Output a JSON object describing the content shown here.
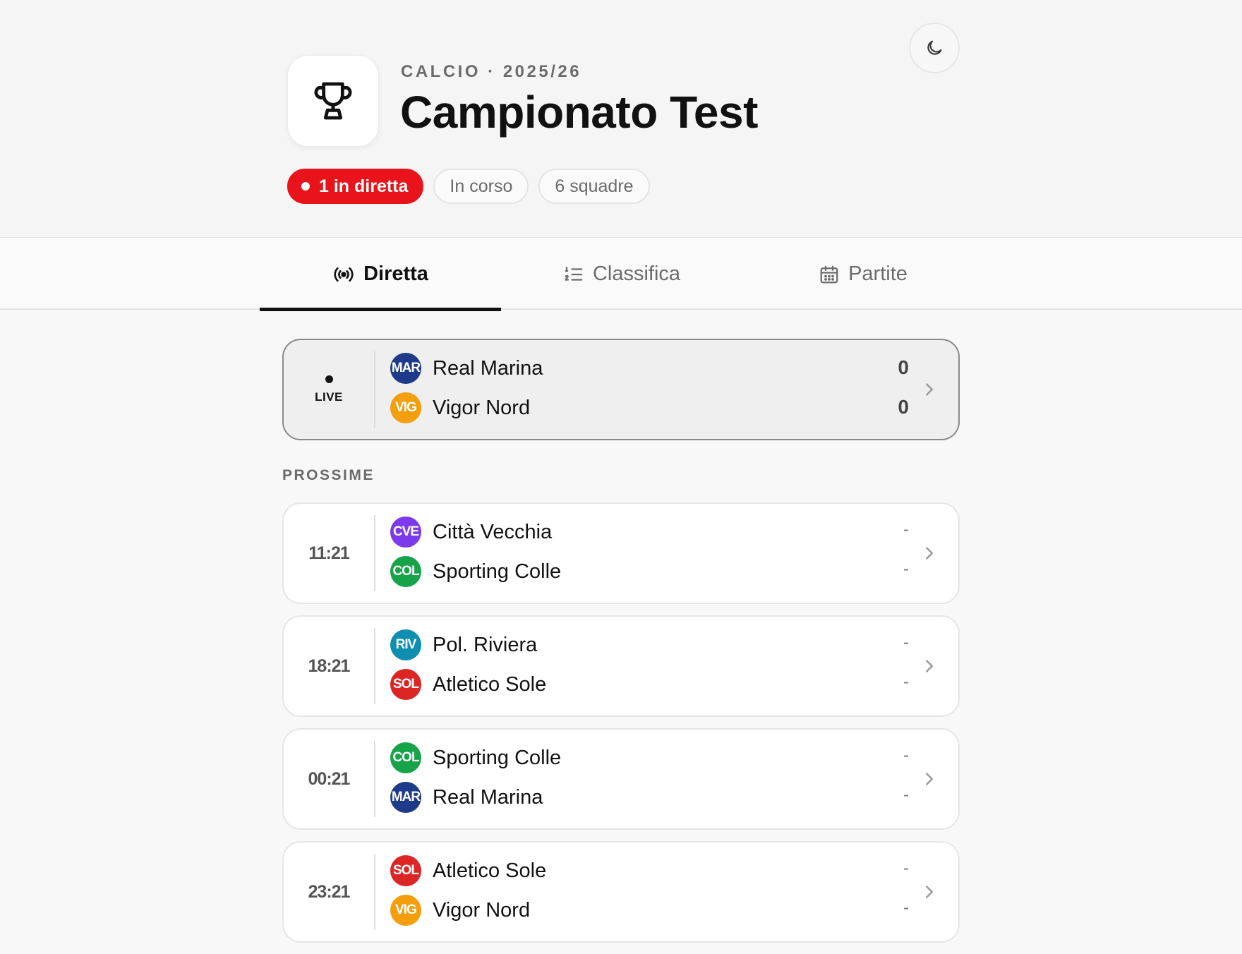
{
  "header": {
    "kicker": "CALCIO · 2025/26",
    "title": "Campionato Test",
    "theme_toggle_icon": "moon-icon",
    "logo_icon": "trophy-icon",
    "pills": {
      "live": "1 in diretta",
      "status": "In corso",
      "teams": "6 squadre"
    }
  },
  "tabs": [
    {
      "label": "Diretta",
      "icon": "broadcast-icon",
      "active": true
    },
    {
      "label": "Classifica",
      "icon": "ranked-list-icon",
      "active": false
    },
    {
      "label": "Partite",
      "icon": "calendar-icon",
      "active": false
    }
  ],
  "live_match": {
    "status": "LIVE",
    "home": {
      "abbr": "MAR",
      "name": "Real Marina",
      "score": "0",
      "color": "#1e3a8a"
    },
    "away": {
      "abbr": "VIG",
      "name": "Vigor Nord",
      "score": "0",
      "color": "#f59e0b"
    }
  },
  "upcoming_label": "PROSSIME",
  "upcoming": [
    {
      "time": "11:21",
      "home": {
        "abbr": "CVE",
        "name": "Città Vecchia",
        "score": "-",
        "color": "#7c3aed"
      },
      "away": {
        "abbr": "COL",
        "name": "Sporting Colle",
        "score": "-",
        "color": "#16a34a"
      }
    },
    {
      "time": "18:21",
      "home": {
        "abbr": "RIV",
        "name": "Pol. Riviera",
        "score": "-",
        "color": "#0e8fb0"
      },
      "away": {
        "abbr": "SOL",
        "name": "Atletico Sole",
        "score": "-",
        "color": "#dc2626"
      }
    },
    {
      "time": "00:21",
      "home": {
        "abbr": "COL",
        "name": "Sporting Colle",
        "score": "-",
        "color": "#16a34a"
      },
      "away": {
        "abbr": "MAR",
        "name": "Real Marina",
        "score": "-",
        "color": "#1e3a8a"
      }
    },
    {
      "time": "23:21",
      "home": {
        "abbr": "SOL",
        "name": "Atletico Sole",
        "score": "-",
        "color": "#dc2626"
      },
      "away": {
        "abbr": "VIG",
        "name": "Vigor Nord",
        "score": "-",
        "color": "#f59e0b"
      }
    }
  ]
}
